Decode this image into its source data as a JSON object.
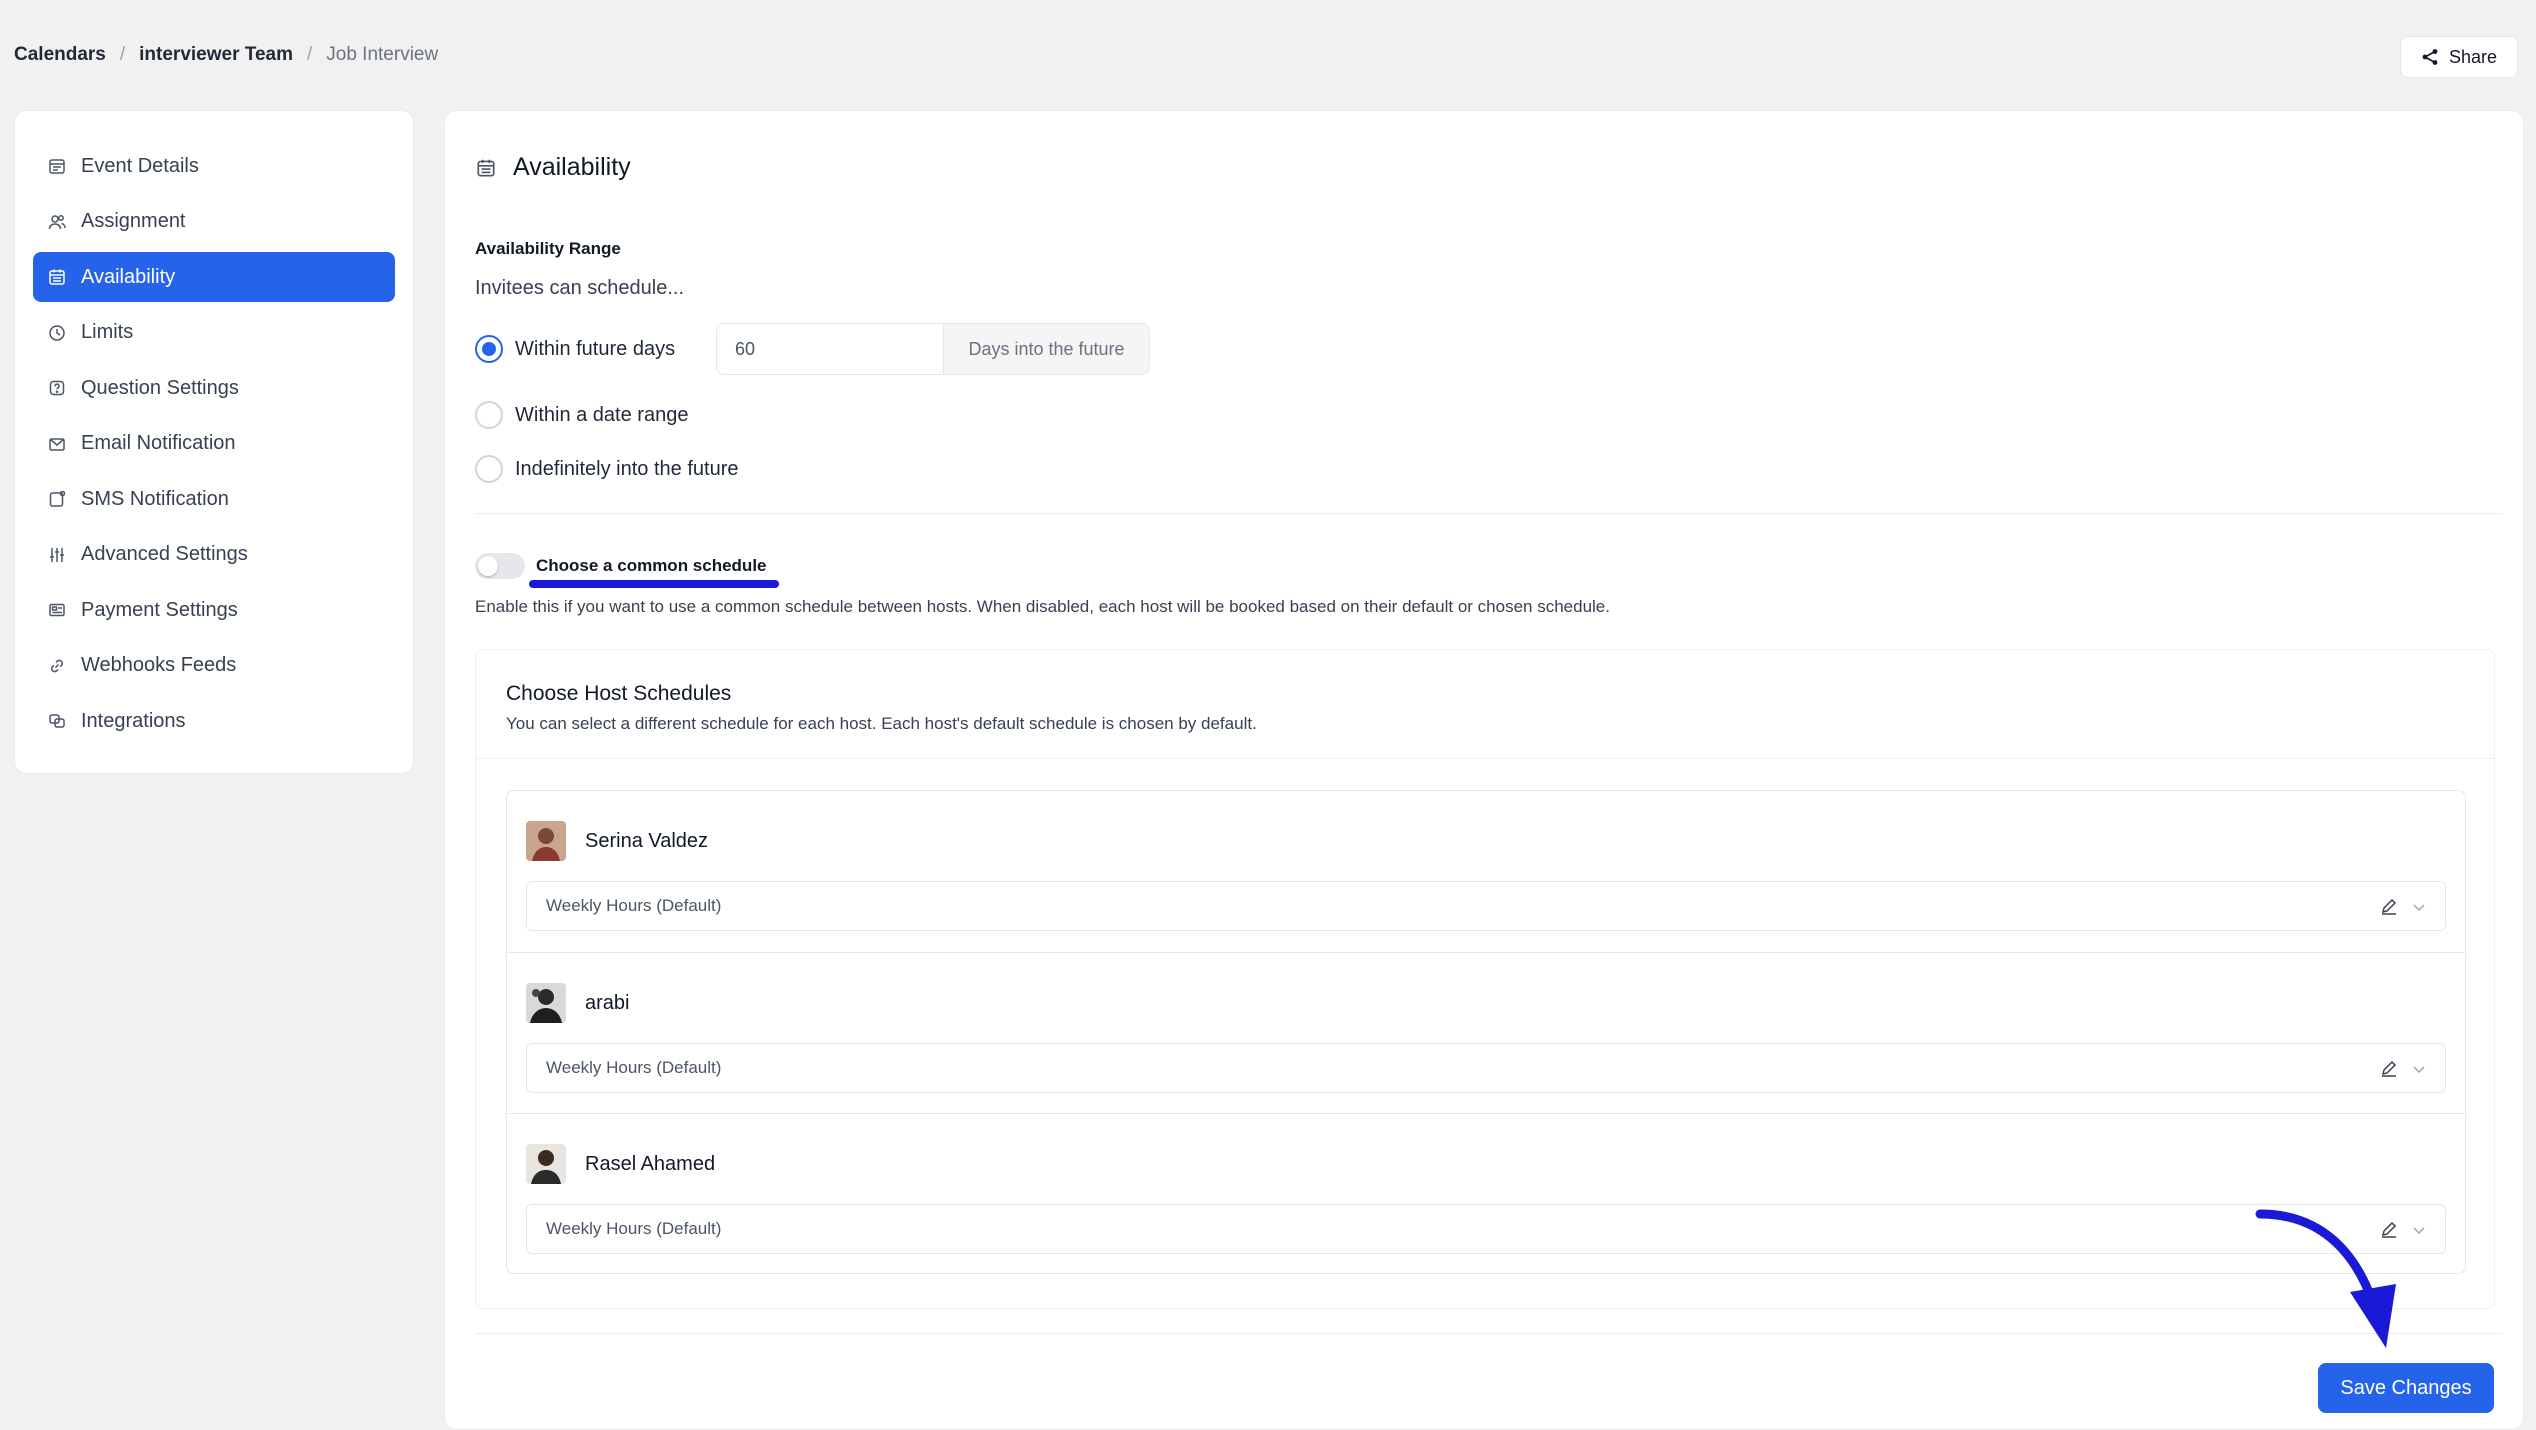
{
  "breadcrumb": {
    "items": [
      "Calendars",
      "interviewer Team",
      "Job Interview"
    ],
    "separator": "/"
  },
  "header": {
    "share_label": "Share",
    "share_icon": "share-icon"
  },
  "sidebar": {
    "items": [
      {
        "label": "Event Details",
        "icon": "calendar-details-icon"
      },
      {
        "label": "Assignment",
        "icon": "users-icon"
      },
      {
        "label": "Availability",
        "icon": "calendar-icon",
        "active": true
      },
      {
        "label": "Limits",
        "icon": "clock-icon"
      },
      {
        "label": "Question Settings",
        "icon": "question-icon"
      },
      {
        "label": "Email Notification",
        "icon": "mail-icon"
      },
      {
        "label": "SMS Notification",
        "icon": "sms-icon"
      },
      {
        "label": "Advanced Settings",
        "icon": "sliders-icon"
      },
      {
        "label": "Payment Settings",
        "icon": "payment-icon"
      },
      {
        "label": "Webhooks Feeds",
        "icon": "link-icon"
      },
      {
        "label": "Integrations",
        "icon": "integrations-icon"
      }
    ]
  },
  "main": {
    "title": "Availability",
    "range_label": "Availability Range",
    "range_sub": "Invitees can schedule...",
    "options": [
      {
        "label": "Within future days",
        "checked": true
      },
      {
        "label": "Within a date range",
        "checked": false
      },
      {
        "label": "Indefinitely into the future",
        "checked": false
      }
    ],
    "days_value": "60",
    "days_suffix": "Days into the future",
    "common_schedule_label": "Choose a common schedule",
    "common_schedule_enabled": false,
    "common_schedule_help": "Enable this if you want to use a common schedule between hosts. When disabled, each host will be booked based on their default or chosen schedule.",
    "host_schedules": {
      "title": "Choose Host Schedules",
      "subtitle": "You can select a different schedule for each host. Each host's default schedule is chosen by default.",
      "hosts": [
        {
          "name": "Serina Valdez",
          "schedule": "Weekly Hours (Default)"
        },
        {
          "name": "arabi",
          "schedule": "Weekly Hours (Default)"
        },
        {
          "name": "Rasel Ahamed",
          "schedule": "Weekly Hours (Default)"
        }
      ]
    },
    "save_label": "Save Changes"
  },
  "colors": {
    "accent": "#2563eb",
    "annotation": "#1a1ad6",
    "background": "#f1f1f1"
  }
}
